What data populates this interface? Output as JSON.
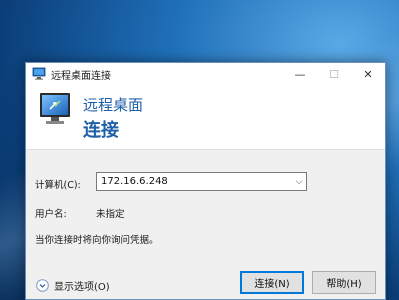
{
  "window": {
    "title": "远程桌面连接",
    "controls": {
      "minimize": "—",
      "maximize": "☐",
      "close": "✕"
    }
  },
  "banner": {
    "subtitle": "远程桌面",
    "title": "连接"
  },
  "form": {
    "computer_label": "计算机(C):",
    "computer_value": "172.16.6.248",
    "username_label": "用户名:",
    "username_value": "未指定",
    "hint": "当你连接时将向你询问凭据。"
  },
  "footer": {
    "options_label": "显示选项(O)",
    "connect_label": "连接(N)",
    "help_label": "帮助(H)"
  },
  "icons": {
    "app": "remote-desktop-icon",
    "options": "chevron-down-circle-icon",
    "combo": "chevron-down-icon"
  }
}
